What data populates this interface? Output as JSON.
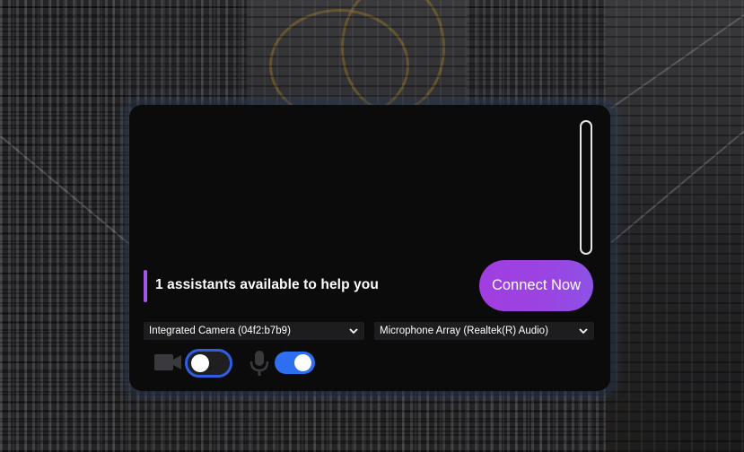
{
  "widget": {
    "status_text": "1 assistants available to help you",
    "connect_button_label": "Connect Now",
    "camera_select": {
      "value": "Integrated Camera (04f2:b7b9)"
    },
    "microphone_select": {
      "value": "Microphone Array (Realtek(R) Audio)"
    },
    "camera_toggle": {
      "on": false,
      "icon": "video-camera-icon"
    },
    "microphone_toggle": {
      "on": true,
      "icon": "microphone-icon"
    }
  },
  "colors": {
    "accent_purple": "#a13ee0",
    "toggle_blue": "#2e6ef0",
    "card_background": "#0b0b0c"
  }
}
